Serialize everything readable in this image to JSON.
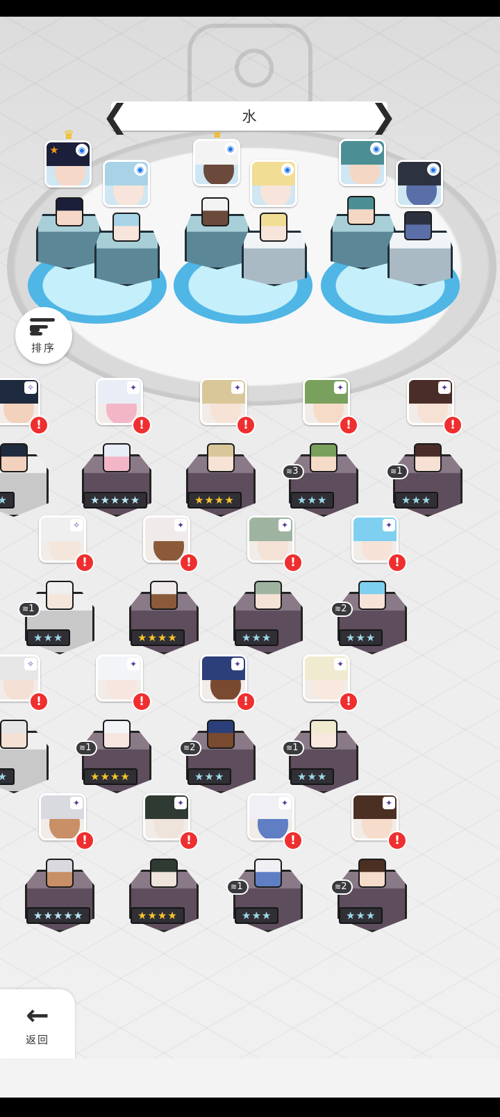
{
  "header": {
    "element_title": "水"
  },
  "controls": {
    "sort_label": "排序",
    "back_label": "返回"
  },
  "glyphs": {
    "prev": "❮",
    "next": "❯",
    "marker": "◉",
    "rank": "✦",
    "spark": "✧",
    "crown": "♛",
    "star": "★",
    "alert": "!",
    "back": "←",
    "stack": "≋"
  },
  "team": [
    {
      "name": "team-slot-1",
      "leader": true,
      "favorite": true,
      "hair": "#1b1f3a",
      "skin": "#f6d8c8",
      "ring": "#3aa0e8"
    },
    {
      "name": "team-slot-2",
      "leader": false,
      "favorite": false,
      "hair": "#a8d3e6",
      "skin": "#f7e4da",
      "ring": "#3aa0e8"
    },
    {
      "name": "team-slot-3",
      "leader": true,
      "favorite": false,
      "hair": "#f3f3f3",
      "skin": "#6b4a3c",
      "ring": "#3aa0e8"
    },
    {
      "name": "team-slot-4",
      "leader": false,
      "favorite": false,
      "hair": "#f2dd94",
      "skin": "#f7e4da",
      "ring": "#3aa0e8"
    },
    {
      "name": "team-slot-5",
      "leader": false,
      "favorite": false,
      "hair": "#4b8f95",
      "skin": "#f4d7c4",
      "ring": "#3aa0e8"
    },
    {
      "name": "team-slot-6",
      "leader": false,
      "favorite": false,
      "hair": "#2c3240",
      "skin": "#5a6fa8",
      "ring": "#3aa0e8"
    }
  ],
  "roster": [
    {
      "row": 0,
      "col": 0,
      "stars": "★★",
      "tier": "silver",
      "dupes": "",
      "hair": "#1e2a3d",
      "skin": "#f3d2bd",
      "pale": true,
      "marker": "✧"
    },
    {
      "row": 0,
      "col": 1,
      "stars": "★★★★★",
      "tier": "rainbow",
      "dupes": "",
      "hair": "#e9eef6",
      "skin": "#f3b6c6",
      "pale": false,
      "marker": "✦"
    },
    {
      "row": 0,
      "col": 2,
      "stars": "★★★★",
      "tier": "gold",
      "dupes": "",
      "hair": "#d9c79a",
      "skin": "#f7e3d6",
      "pale": false,
      "marker": "✦"
    },
    {
      "row": 0,
      "col": 3,
      "stars": "★★★",
      "tier": "silver",
      "dupes": "3",
      "hair": "#7aa05d",
      "skin": "#f6dcc8",
      "pale": false,
      "marker": "✦"
    },
    {
      "row": 0,
      "col": 4,
      "stars": "★★★",
      "tier": "silver",
      "dupes": "1",
      "hair": "#4a2d28",
      "skin": "#f7e0d4",
      "pale": false,
      "marker": "✦"
    },
    {
      "row": 1,
      "col": 0,
      "stars": "★★★",
      "tier": "silver",
      "dupes": "1",
      "hair": "#efefef",
      "skin": "#f5e6dc",
      "pale": true,
      "marker": "✧"
    },
    {
      "row": 1,
      "col": 1,
      "stars": "★★★★",
      "tier": "gold",
      "dupes": "",
      "hair": "#f0eaea",
      "skin": "#8a5a3a",
      "pale": false,
      "marker": "✦"
    },
    {
      "row": 1,
      "col": 2,
      "stars": "★★★",
      "tier": "silver",
      "dupes": "",
      "hair": "#9fb3a1",
      "skin": "#f5e2d6",
      "pale": false,
      "marker": "✦"
    },
    {
      "row": 1,
      "col": 3,
      "stars": "★★★",
      "tier": "silver",
      "dupes": "2",
      "hair": "#7fd0f0",
      "skin": "#f7e2d8",
      "pale": false,
      "marker": "✦"
    },
    {
      "row": 2,
      "col": 0,
      "stars": "★★",
      "tier": "silver",
      "dupes": "",
      "hair": "#e6e6e6",
      "skin": "#f5e0d6",
      "pale": true,
      "marker": "✧"
    },
    {
      "row": 2,
      "col": 1,
      "stars": "★★★★",
      "tier": "gold",
      "dupes": "1",
      "hair": "#f2f4f8",
      "skin": "#f7e6df",
      "pale": false,
      "marker": "✦"
    },
    {
      "row": 2,
      "col": 2,
      "stars": "★★★",
      "tier": "silver",
      "dupes": "2",
      "hair": "#2c3f7a",
      "skin": "#7a4a30",
      "pale": false,
      "marker": "✦"
    },
    {
      "row": 2,
      "col": 3,
      "stars": "★★★",
      "tier": "silver",
      "dupes": "1",
      "hair": "#f0ead0",
      "skin": "#f8e8de",
      "pale": false,
      "marker": "✦"
    },
    {
      "row": 3,
      "col": 0,
      "stars": "★★★★★",
      "tier": "rainbow",
      "dupes": "",
      "hair": "#d9d9e0",
      "skin": "#c98f66",
      "pale": false,
      "marker": "✦"
    },
    {
      "row": 3,
      "col": 1,
      "stars": "★★★★",
      "tier": "gold",
      "dupes": "",
      "hair": "#2f3a33",
      "skin": "#efe4dc",
      "pale": false,
      "marker": "✦"
    },
    {
      "row": 3,
      "col": 2,
      "stars": "★★★",
      "tier": "silver",
      "dupes": "1",
      "hair": "#f0f0f4",
      "skin": "#5f7ec4",
      "pale": false,
      "marker": "✦"
    },
    {
      "row": 3,
      "col": 3,
      "stars": "★★★",
      "tier": "silver",
      "dupes": "2",
      "hair": "#4a2f22",
      "skin": "#f6dccb",
      "pale": false,
      "marker": "✦"
    }
  ]
}
